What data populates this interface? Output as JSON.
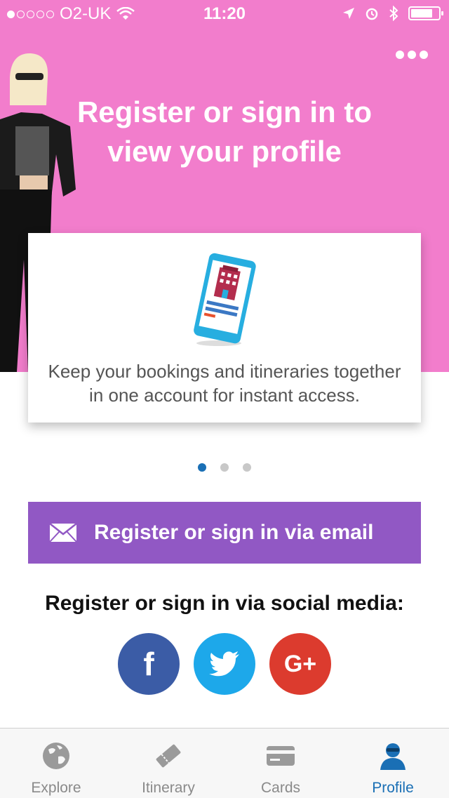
{
  "status_bar": {
    "carrier": "O2-UK",
    "time": "11:20"
  },
  "hero": {
    "title_line1": "Register or sign in to",
    "title_line2": "view your profile"
  },
  "card": {
    "text": "Keep your bookings and itineraries together in one account for instant access."
  },
  "pager": {
    "count": 3,
    "active_index": 0
  },
  "email_button": {
    "label": "Register or sign in via email",
    "icon": "mail-icon"
  },
  "social": {
    "title": "Register or sign in via social media:",
    "buttons": [
      {
        "name": "facebook",
        "glyph": "f",
        "color": "#3b5ca6"
      },
      {
        "name": "twitter",
        "color": "#1da8ea"
      },
      {
        "name": "google-plus",
        "glyph": "G+",
        "color": "#dc3b2e"
      }
    ]
  },
  "tabs": [
    {
      "label": "Explore",
      "icon": "globe-icon"
    },
    {
      "label": "Itinerary",
      "icon": "ticket-icon"
    },
    {
      "label": "Cards",
      "icon": "card-icon"
    },
    {
      "label": "Profile",
      "icon": "person-icon",
      "active": true
    }
  ],
  "colors": {
    "hero_bg": "#f27dcc",
    "email_btn": "#9158c4",
    "active_tab": "#1a6fb5"
  }
}
